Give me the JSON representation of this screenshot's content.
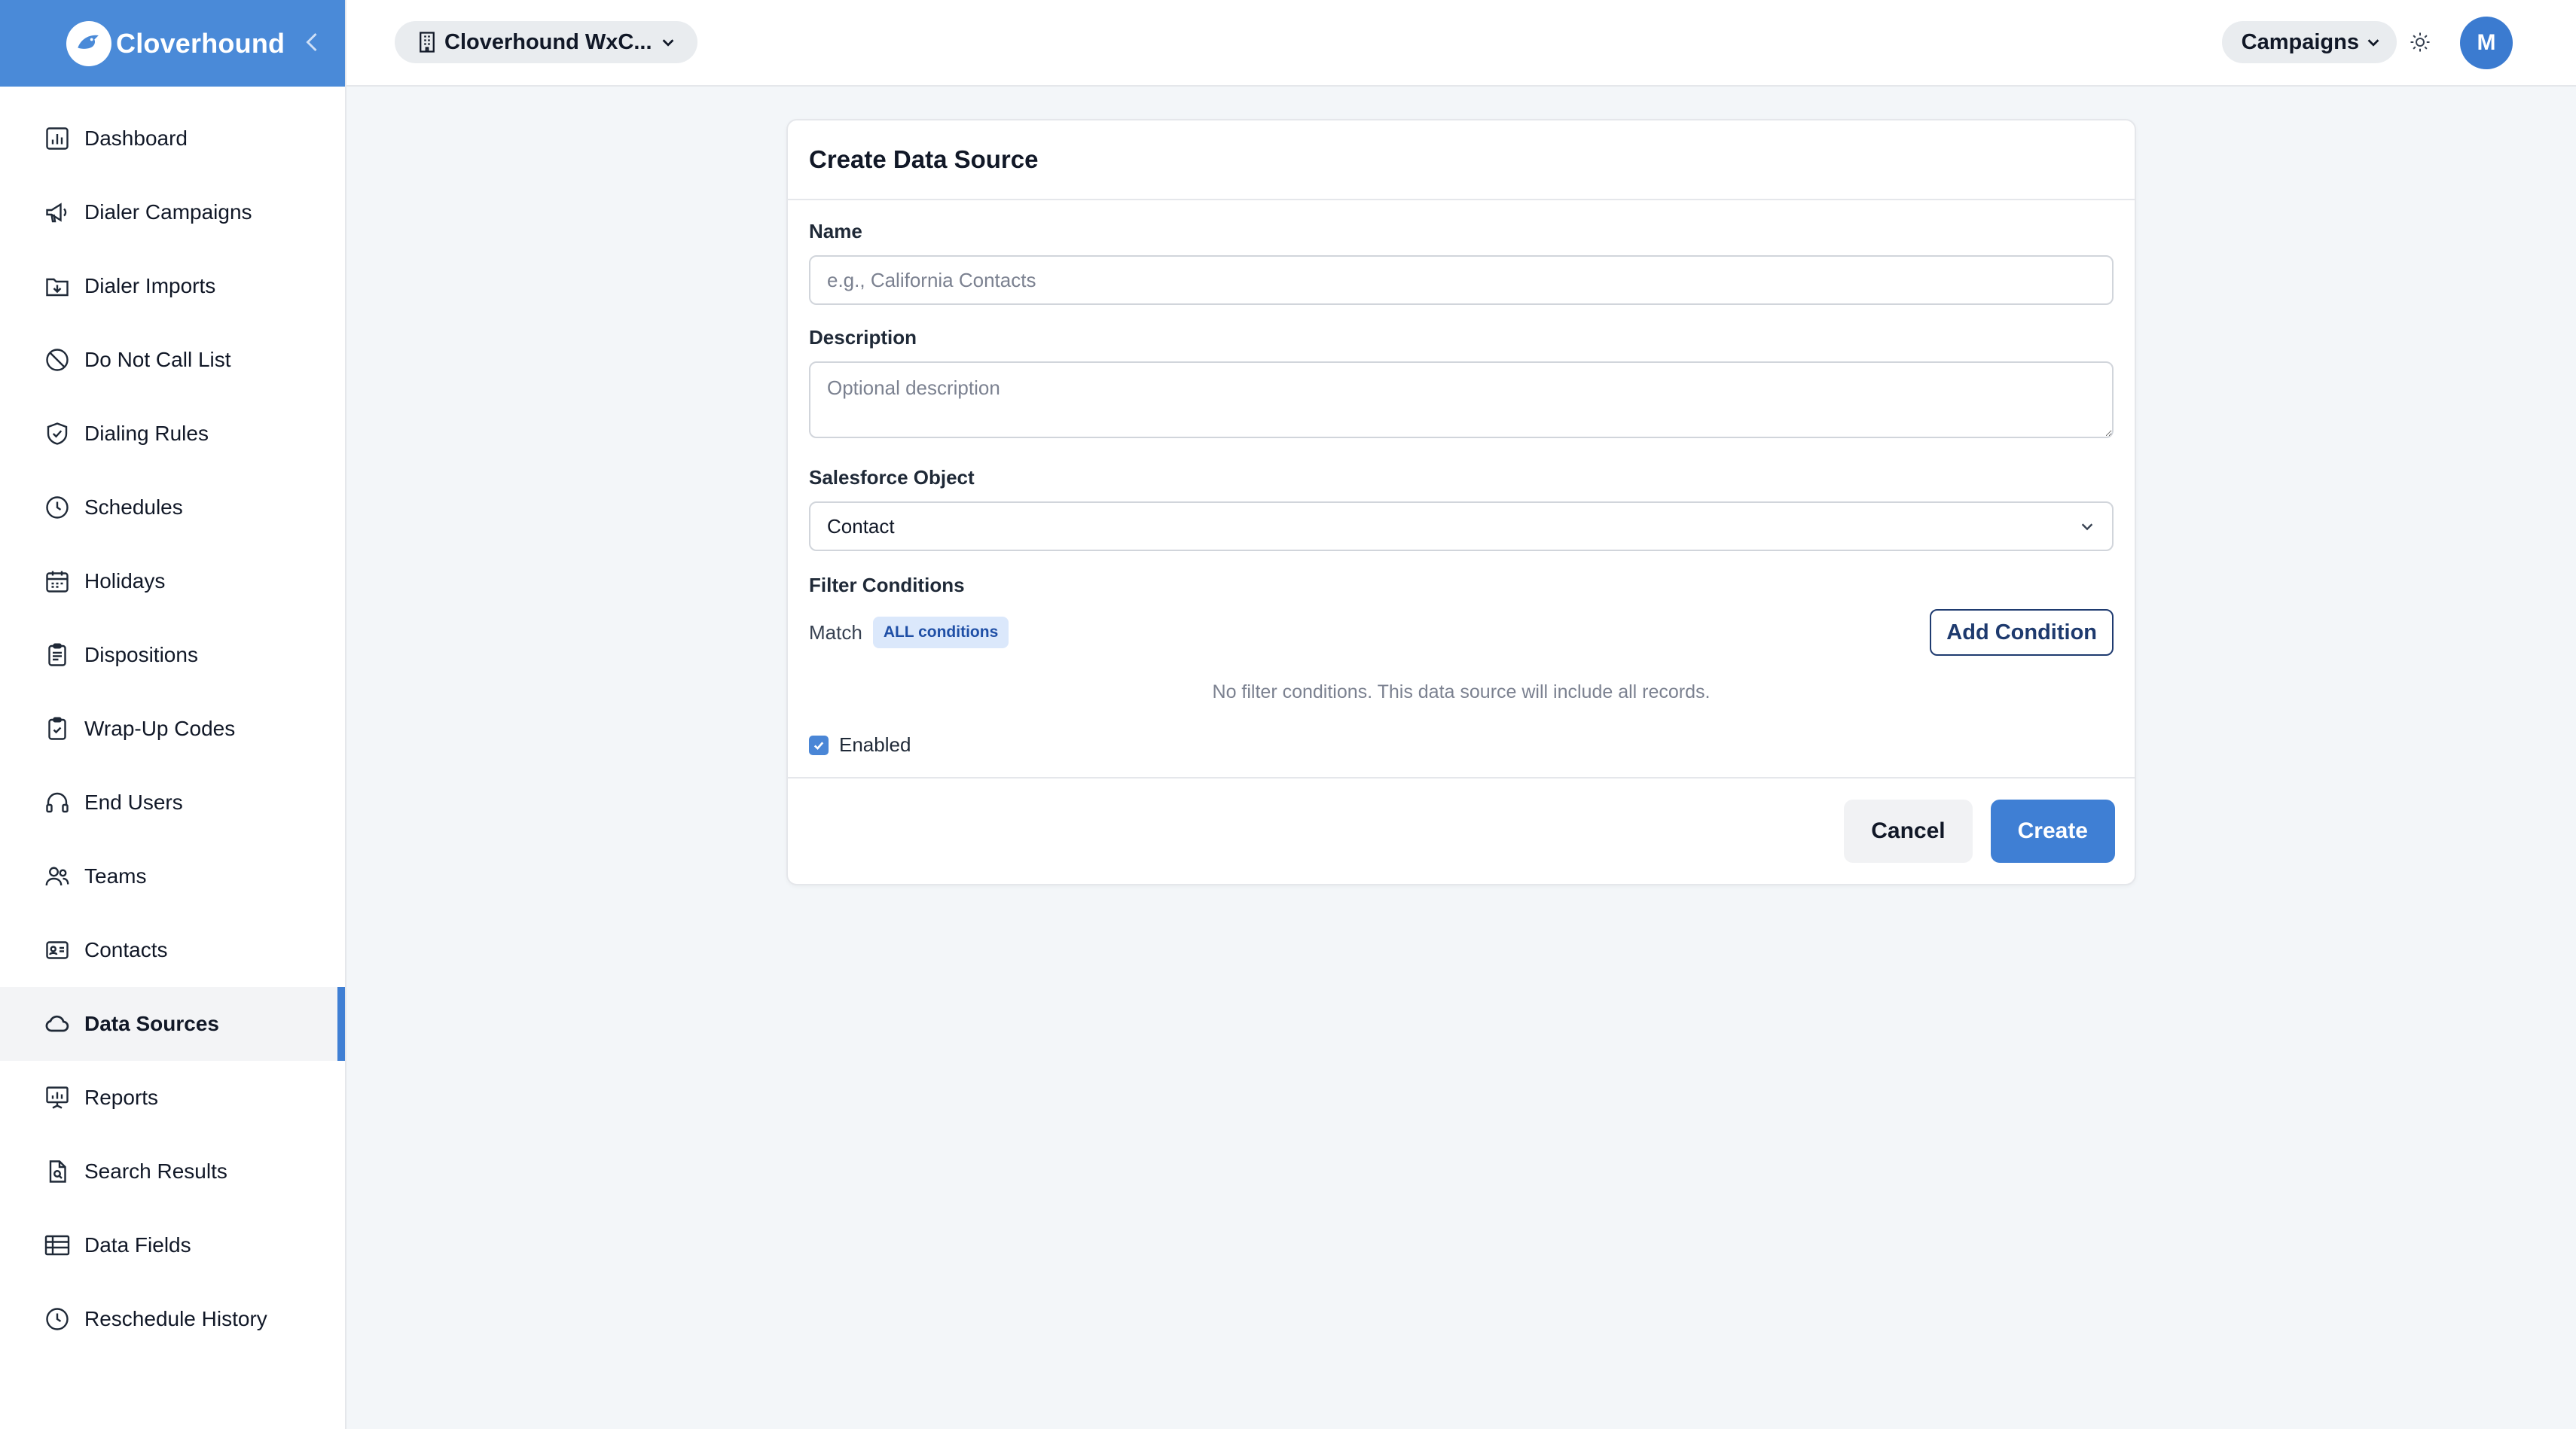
{
  "brand": {
    "name": "Cloverhound"
  },
  "sidebar": {
    "items": [
      {
        "label": "Dashboard",
        "icon": "chart-icon"
      },
      {
        "label": "Dialer Campaigns",
        "icon": "megaphone-icon"
      },
      {
        "label": "Dialer Imports",
        "icon": "import-icon"
      },
      {
        "label": "Do Not Call List",
        "icon": "ban-icon"
      },
      {
        "label": "Dialing Rules",
        "icon": "shield-check-icon"
      },
      {
        "label": "Schedules",
        "icon": "clock-icon"
      },
      {
        "label": "Holidays",
        "icon": "calendar-icon"
      },
      {
        "label": "Dispositions",
        "icon": "clipboard-icon"
      },
      {
        "label": "Wrap-Up Codes",
        "icon": "clipboard-check-icon"
      },
      {
        "label": "End Users",
        "icon": "headset-icon"
      },
      {
        "label": "Teams",
        "icon": "users-icon"
      },
      {
        "label": "Contacts",
        "icon": "id-card-icon"
      },
      {
        "label": "Data Sources",
        "icon": "cloud-icon",
        "active": true
      },
      {
        "label": "Reports",
        "icon": "presentation-chart-icon"
      },
      {
        "label": "Search Results",
        "icon": "file-search-icon"
      },
      {
        "label": "Data Fields",
        "icon": "table-icon"
      },
      {
        "label": "Reschedule History",
        "icon": "clock-icon"
      }
    ]
  },
  "topbar": {
    "org_label": "Cloverhound WxC...",
    "campaigns_label": "Campaigns",
    "avatar_initial": "M"
  },
  "form": {
    "title": "Create Data Source",
    "name_label": "Name",
    "name_placeholder": "e.g., California Contacts",
    "description_label": "Description",
    "description_placeholder": "Optional description",
    "object_label": "Salesforce Object",
    "object_value": "Contact",
    "filter_label": "Filter Conditions",
    "match_label": "Match",
    "match_badge": "ALL conditions",
    "add_condition_label": "Add Condition",
    "empty_note": "No filter conditions. This data source will include all records.",
    "enabled_label": "Enabled",
    "cancel_label": "Cancel",
    "create_label": "Create"
  },
  "colors": {
    "brand": "#4a8ad8",
    "primary": "#3f7fd4",
    "active_bg": "#f3f4f6"
  }
}
